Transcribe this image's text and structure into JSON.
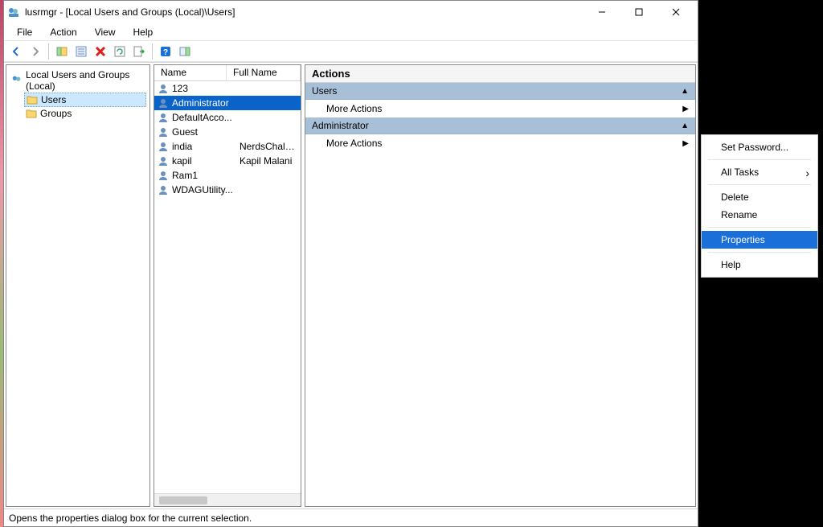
{
  "window": {
    "title": "lusrmgr - [Local Users and Groups (Local)\\Users]"
  },
  "menubar": {
    "file": "File",
    "action": "Action",
    "view": "View",
    "help": "Help"
  },
  "tree": {
    "root": "Local Users and Groups (Local)",
    "users": "Users",
    "groups": "Groups"
  },
  "list": {
    "header_name": "Name",
    "header_full": "Full Name",
    "rows": [
      {
        "name": "123",
        "full": ""
      },
      {
        "name": "Administrator",
        "full": ""
      },
      {
        "name": "DefaultAcco...",
        "full": ""
      },
      {
        "name": "Guest",
        "full": ""
      },
      {
        "name": "india",
        "full": "NerdsChalk ID"
      },
      {
        "name": "kapil",
        "full": "Kapil Malani"
      },
      {
        "name": "Ram1",
        "full": ""
      },
      {
        "name": "WDAGUtility...",
        "full": ""
      }
    ],
    "selected_index": 1
  },
  "actions": {
    "header": "Actions",
    "group1": "Users",
    "group2": "Administrator",
    "more": "More Actions"
  },
  "statusbar": {
    "text": "Opens the properties dialog box for the current selection."
  },
  "context_menu": {
    "set_password": "Set Password...",
    "all_tasks": "All Tasks",
    "delete": "Delete",
    "rename": "Rename",
    "properties": "Properties",
    "help": "Help"
  }
}
